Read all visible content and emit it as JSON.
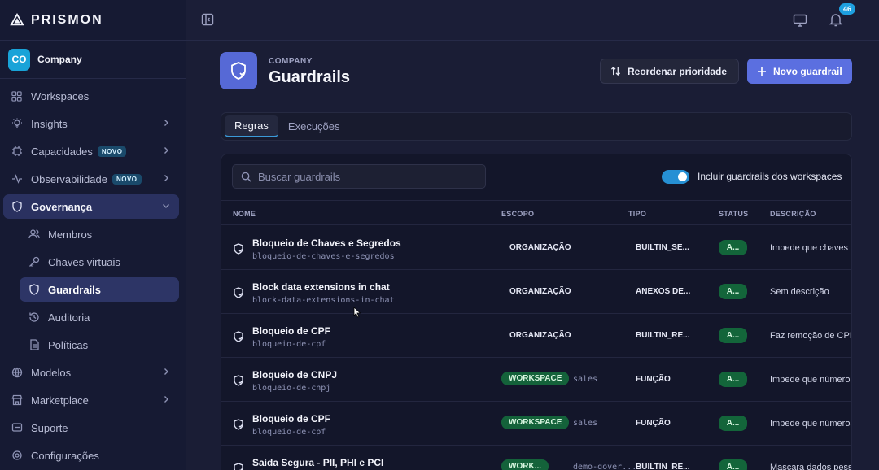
{
  "brand": {
    "name": "PRISMON"
  },
  "company": {
    "initials": "CO",
    "name": "Company"
  },
  "nav": {
    "items": [
      {
        "label": "Workspaces",
        "icon": "grid-icon"
      },
      {
        "label": "Insights",
        "icon": "lightbulb-icon"
      },
      {
        "label": "Capacidades",
        "icon": "capabilities-icon",
        "badge": "NOVO"
      },
      {
        "label": "Observabilidade",
        "icon": "activity-icon",
        "badge": "NOVO"
      },
      {
        "label": "Governança",
        "icon": "shield-icon"
      },
      {
        "label": "Membros",
        "icon": "users-icon"
      },
      {
        "label": "Chaves virtuais",
        "icon": "key-icon"
      },
      {
        "label": "Guardrails",
        "icon": "shield-icon"
      },
      {
        "label": "Auditoria",
        "icon": "history-icon"
      },
      {
        "label": "Políticas",
        "icon": "document-icon"
      },
      {
        "label": "Modelos",
        "icon": "globe-icon"
      },
      {
        "label": "Marketplace",
        "icon": "store-icon"
      },
      {
        "label": "Suporte",
        "icon": "support-icon"
      },
      {
        "label": "Configurações",
        "icon": "gear-icon"
      }
    ]
  },
  "topbar": {
    "notifications_count": "46"
  },
  "header": {
    "eyebrow": "COMPANY",
    "title": "Guardrails",
    "reorder_label": "Reordenar prioridade",
    "new_label": "Novo guardrail"
  },
  "tabs": [
    "Regras",
    "Execuções"
  ],
  "filters": {
    "search_placeholder": "Buscar guardrails",
    "toggle_label": "Incluir guardrails dos workspaces"
  },
  "table": {
    "headers": [
      "NOME",
      "ESCOPO",
      "TIPO",
      "STATUS",
      "DESCRIÇÃO"
    ],
    "rows": [
      {
        "name": "Bloqueio de Chaves e Segredos",
        "slug": "bloqueio-de-chaves-e-segredos",
        "scope": "ORGANIZAÇÃO",
        "scope_extra": "",
        "type": "BUILTIN_SE...",
        "status": "A...",
        "desc": "Impede que chaves e"
      },
      {
        "name": "Block data extensions in chat",
        "slug": "block-data-extensions-in-chat",
        "scope": "ORGANIZAÇÃO",
        "scope_extra": "",
        "type": "ANEXOS DE...",
        "status": "A...",
        "desc": "Sem descrição"
      },
      {
        "name": "Bloqueio de CPF",
        "slug": "bloqueio-de-cpf",
        "scope": "ORGANIZAÇÃO",
        "scope_extra": "",
        "type": "BUILTIN_RE...",
        "status": "A...",
        "desc": "Faz remoção de CPF"
      },
      {
        "name": "Bloqueio de CNPJ",
        "slug": "bloqueio-de-cnpj",
        "scope": "WORKSPACE",
        "scope_extra": "sales",
        "type": "FUNÇÃO",
        "status": "A...",
        "desc": "Impede que números"
      },
      {
        "name": "Bloqueio de CPF",
        "slug": "bloqueio-de-cpf",
        "scope": "WORKSPACE",
        "scope_extra": "sales",
        "type": "FUNÇÃO",
        "status": "A...",
        "desc": "Impede que números"
      },
      {
        "name": "Saída Segura - PII, PHI e PCI",
        "slug": "",
        "scope": "WORK...",
        "scope_extra": "demo-gover...",
        "type": "BUILTIN_RE...",
        "status": "A...",
        "desc": "Mascara dados pess"
      }
    ]
  }
}
